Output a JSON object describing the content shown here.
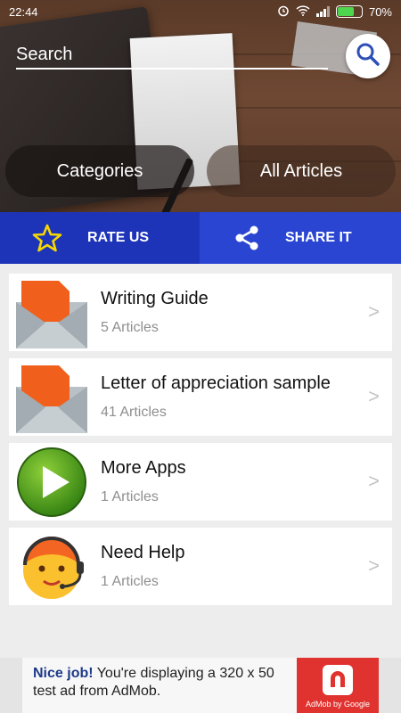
{
  "status_bar": {
    "time": "22:44",
    "battery_percent": "70%",
    "battery_level": 0.7,
    "icons": [
      "alarm-icon",
      "wifi-icon",
      "signal-icon",
      "battery-icon"
    ]
  },
  "search": {
    "placeholder": "Search",
    "button_icon": "search-icon"
  },
  "tabs": {
    "categories_label": "Categories",
    "all_articles_label": "All Articles"
  },
  "actions": {
    "rate_label": "RATE US",
    "rate_icon": "star-icon",
    "share_label": "SHARE IT",
    "share_icon": "share-icon",
    "rate_color": "#1e34b8",
    "share_color": "#2a45d2"
  },
  "categories": [
    {
      "title": "Writing Guide",
      "count": "5 Articles",
      "icon": "envelope-icon",
      "chevron": ">"
    },
    {
      "title": "Letter of appreciation sample",
      "count": "41 Articles",
      "icon": "envelope-icon",
      "chevron": ">"
    },
    {
      "title": "More Apps",
      "count": "1 Articles",
      "icon": "play-icon",
      "chevron": ">"
    },
    {
      "title": "Need Help",
      "count": "1 Articles",
      "icon": "support-agent-icon",
      "chevron": ">"
    }
  ],
  "ad": {
    "headline": "Nice job!",
    "body": "You're displaying a 320 x 50 test ad from AdMob.",
    "brand": "AdMob by Google",
    "brand_color": "#e0332f"
  }
}
